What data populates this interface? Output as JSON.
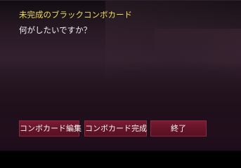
{
  "dialog": {
    "title": "未完成のブラックコンボカード",
    "prompt": "何がしたいですか？"
  },
  "buttons": {
    "edit_label": "コンボカード編集",
    "complete_label": "コンボカード完成",
    "exit_label": "終了"
  },
  "colors": {
    "title_text": "#f0dc5a",
    "body_text": "#f2f2f2",
    "button_fill": "#651428",
    "button_border": "#8a2a40",
    "panel_background": "#2a1a27"
  }
}
